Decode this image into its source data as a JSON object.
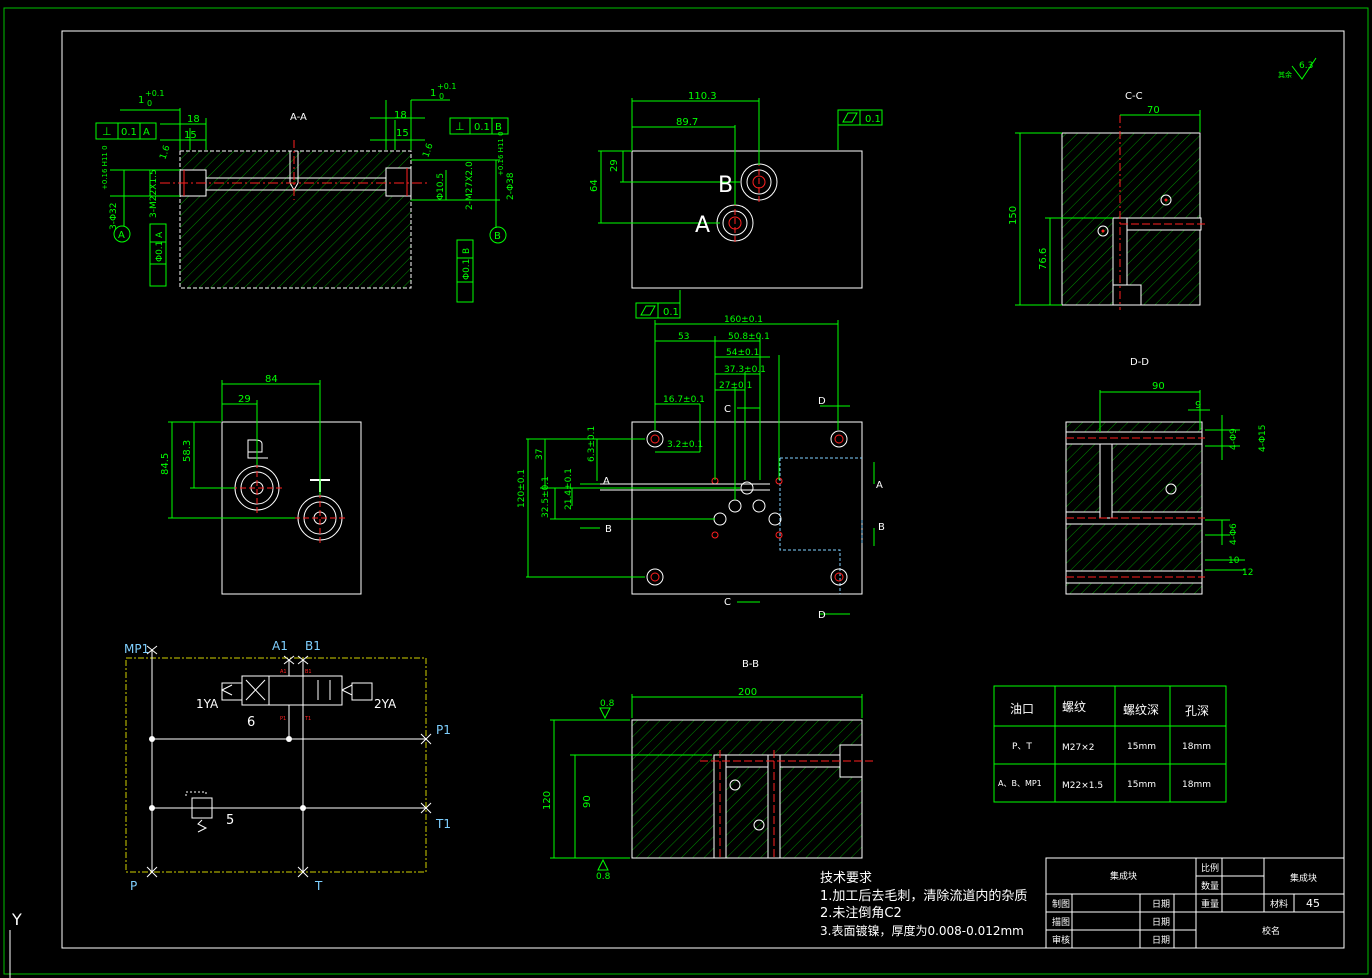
{
  "colors": {
    "background": "#000000",
    "line": "#ffffff",
    "dimension": "#00ff00",
    "centerline": "#ff2020",
    "hatch": "#00a000",
    "cyan": "#7fd0ff",
    "yellow": "#d0d000"
  },
  "views": {
    "aa": {
      "title": "A-A",
      "dims": {
        "d18l": "18",
        "d15l": "15",
        "d1l": "1",
        "tol_l_plus": "+0.1",
        "tol_l_zero": "0",
        "d18r": "18",
        "d15r": "15",
        "d1r": "1",
        "tol_r_plus": "+0.1",
        "tol_r_zero": "0",
        "rough_l": "1.6",
        "rough_r": "1.6",
        "hole_l_1": "3-Φ32",
        "hole_l_tol": "+0.16 H11 0",
        "hole_l_2": "3-M22X1.5",
        "hole_r_1": "2-Φ38",
        "hole_r_tol": "+0.16 H11 0",
        "hole_r_2": "2-M27X2.0",
        "inner": "Φ10.5"
      },
      "frames": {
        "perp_l_val": "0.1",
        "perp_l_ref": "A",
        "perp_r_val": "0.1",
        "perp_r_ref": "B",
        "pos_l_val": "Φ0.1",
        "pos_l_ref": "A",
        "pos_r_val": "Φ0.1",
        "pos_r_ref": "B"
      },
      "datum_l": "A",
      "datum_r": "B"
    },
    "top": {
      "dims": {
        "w1": "110.3",
        "w2": "89.7",
        "h1": "29",
        "h2": "64"
      },
      "letter_b": "B",
      "letter_a": "A",
      "flat_top": "0.1",
      "flat_bottom": "0.1"
    },
    "cc": {
      "title": "C-C",
      "d70": "70",
      "d150": "150",
      "d766": "76.6"
    },
    "left": {
      "d84": "84",
      "d29": "29",
      "d845": "84.5",
      "d583": "58.3"
    },
    "main": {
      "d160": "160±0.1",
      "d53": "53",
      "d508": "50.8±0.1",
      "d54": "54±0.1",
      "d373": "37.3±0.1",
      "d27": "27±0.1",
      "d167": "16.7±0.1",
      "d32": "3.2±0.1",
      "d37": "37",
      "d63": "6.3±0.1",
      "d120": "120±0.1",
      "d325": "32.5±0.1",
      "d214": "21.4±0.1",
      "sec_c": "C",
      "sec_d": "D",
      "sec_a": "A",
      "sec_b": "B"
    },
    "dd": {
      "title": "D-D",
      "d90": "90",
      "d9": "9",
      "d4a": "4-Φ9",
      "d4b": "4-Φ15",
      "d4c": "4-Φ6",
      "d10": "10",
      "d12": "12"
    },
    "bb": {
      "title": "B-B",
      "d200": "200",
      "d120": "120",
      "d90": "90",
      "rough_top": "0.8",
      "rough_bottom": "0.8"
    }
  },
  "roughness": {
    "label": "其余",
    "value": "6.3"
  },
  "schematic": {
    "mp1": "MP1",
    "a1": "A1",
    "b1": "B1",
    "p1": "P1",
    "t1": "T1",
    "p": "P",
    "t": "T",
    "ya1": "1YA",
    "ya2": "2YA",
    "n6": "6",
    "n5": "5",
    "pa": "A1",
    "pb": "B1",
    "pp": "P1",
    "pt": "T1"
  },
  "thread_table": {
    "headers": [
      "油口",
      "螺纹",
      "螺纹深",
      "孔深"
    ],
    "rows": [
      [
        "P、T",
        "M27×2",
        "15mm",
        "18mm"
      ],
      [
        "A、B、MP1",
        "M22×1.5",
        "15mm",
        "18mm"
      ]
    ]
  },
  "tech_notes": {
    "title": "技术要求",
    "lines": [
      "1.加工后去毛刺，清除流道内的杂质",
      "2.未注倒角C2",
      "3.表面镀镍，厚度为0.008-0.012mm"
    ]
  },
  "title_block": {
    "name": "集成块",
    "name2": "集成块",
    "scale_label": "比例",
    "qty_label": "数量",
    "weight_label": "重量",
    "material_label": "材料",
    "material_value": "45",
    "drawn": "制图",
    "traced": "描图",
    "checked": "审核",
    "date": "日期",
    "school": "校名"
  },
  "ucs": "Y"
}
